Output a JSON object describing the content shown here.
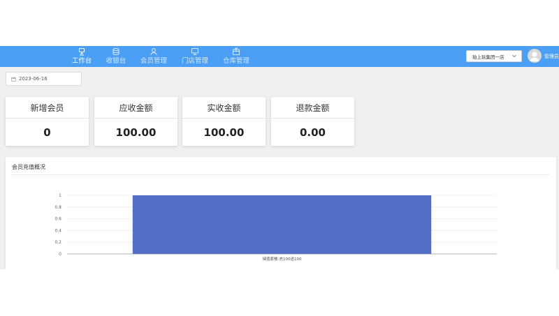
{
  "nav": {
    "items": [
      {
        "label": "工作台",
        "icon": "workbench-icon",
        "active": true
      },
      {
        "label": "收银台",
        "icon": "cashier-icon",
        "active": false
      },
      {
        "label": "会员管理",
        "icon": "member-icon",
        "active": false
      },
      {
        "label": "门店管理",
        "icon": "store-icon",
        "active": false
      },
      {
        "label": "仓库管理",
        "icon": "warehouse-icon",
        "active": false
      }
    ],
    "store_select": "珀上玩集团一店",
    "username": "管理员"
  },
  "filter": {
    "date": "2023-06-16"
  },
  "stats": [
    {
      "label": "新增会员",
      "value": "0"
    },
    {
      "label": "应收金额",
      "value": "100.00"
    },
    {
      "label": "实收金额",
      "value": "100.00"
    },
    {
      "label": "退款金额",
      "value": "0.00"
    }
  ],
  "panel": {
    "title": "会员充值概况"
  },
  "colors": {
    "topbar": "#4a9ef3",
    "bar": "#5470c6"
  },
  "chart_data": {
    "type": "bar",
    "categories": [
      "储值套餐-充100送100"
    ],
    "values": [
      1
    ],
    "title": "",
    "xlabel": "",
    "ylabel": "",
    "ylim": [
      0,
      1
    ],
    "yticks": [
      "0",
      "0.2",
      "0.4",
      "0.6",
      "0.8",
      "1"
    ],
    "grid": true
  }
}
